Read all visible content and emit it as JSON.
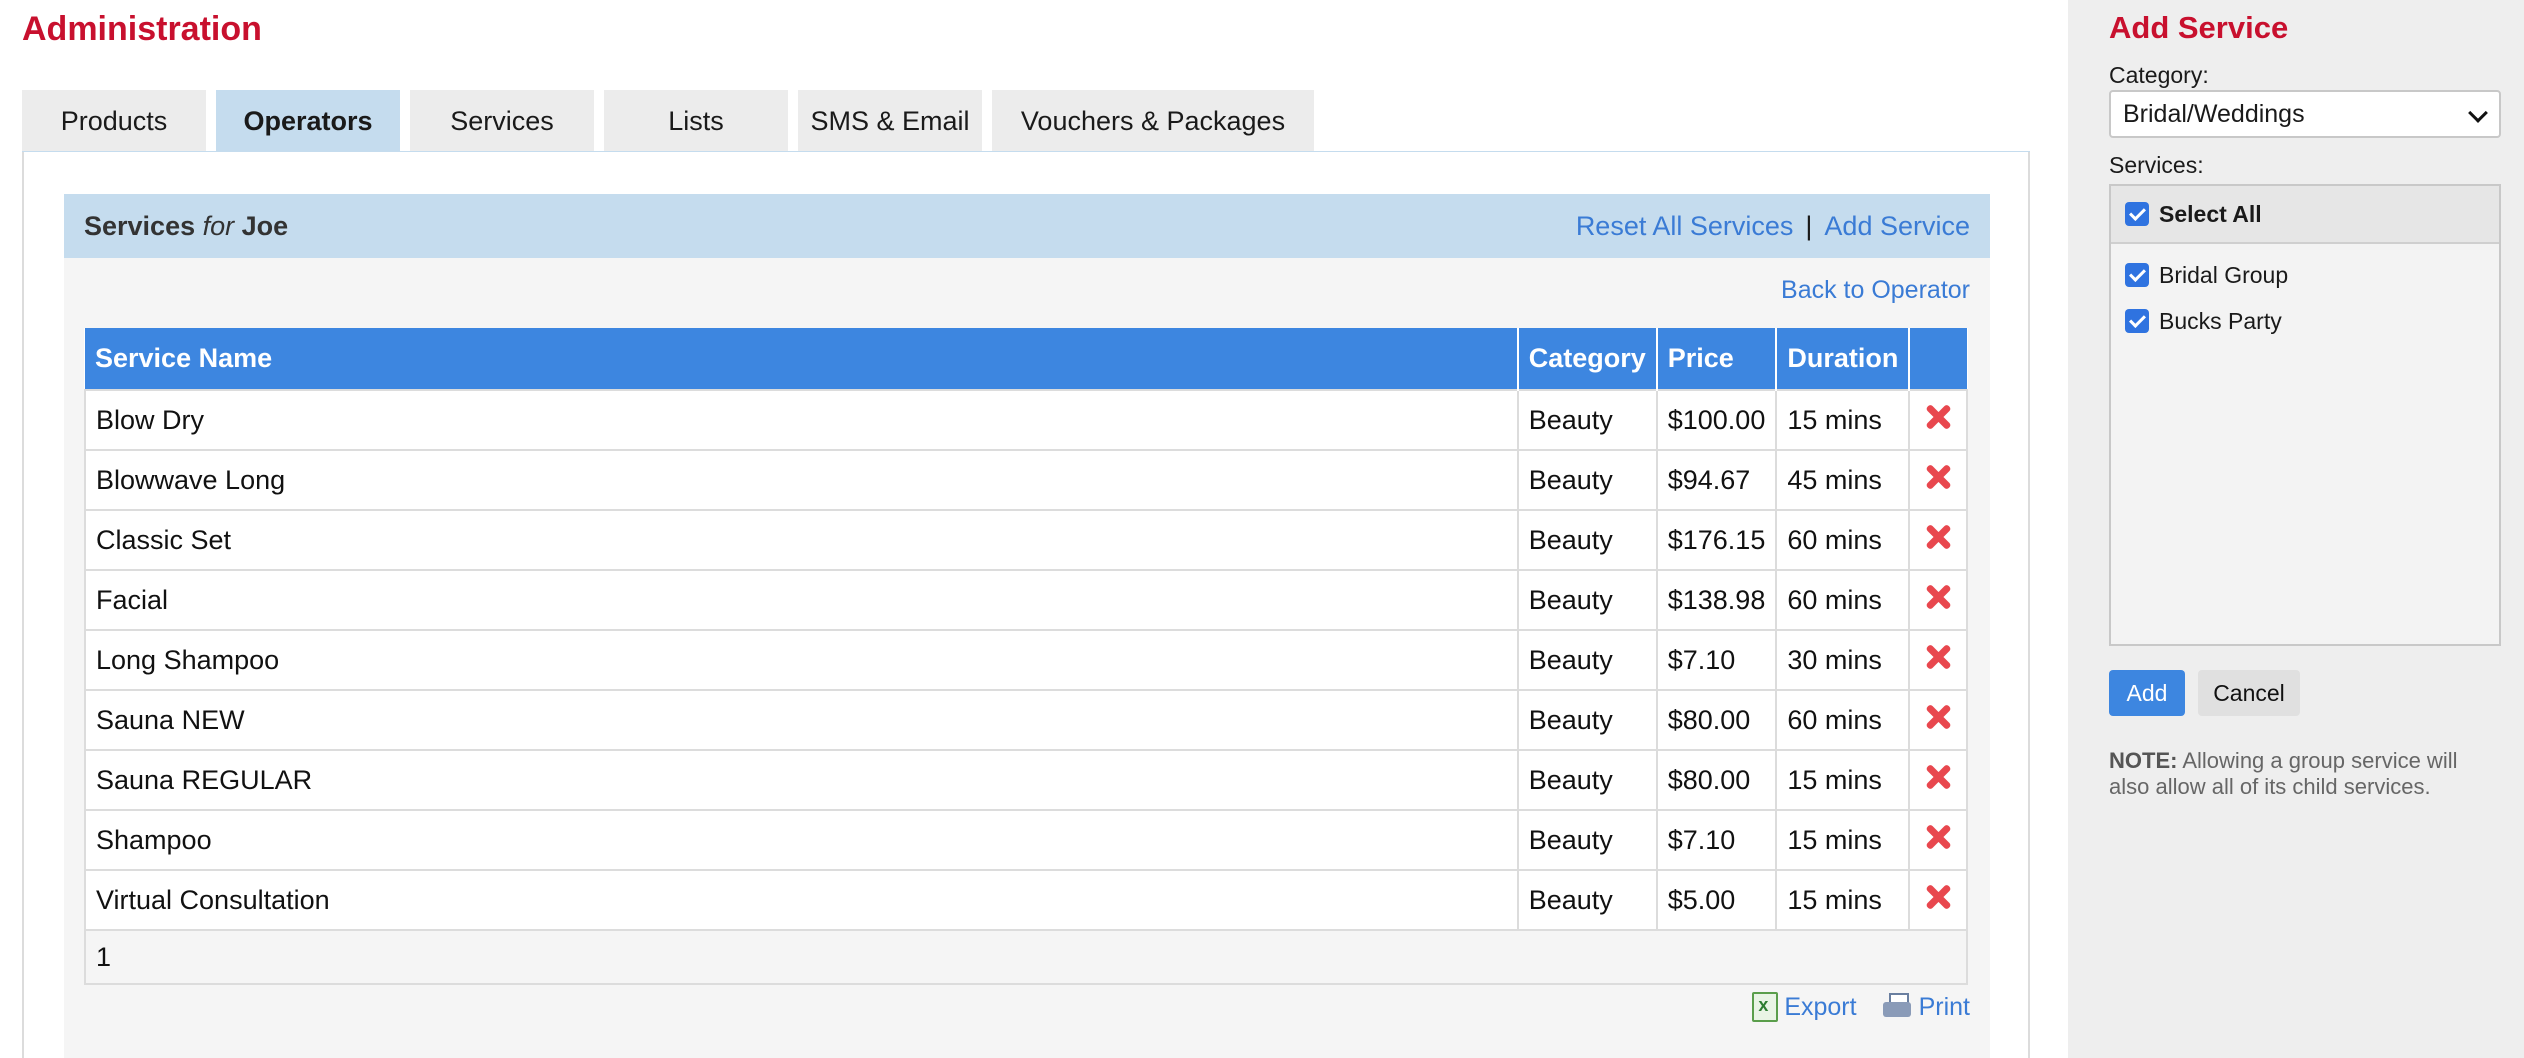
{
  "page": {
    "title": "Administration"
  },
  "tabs": [
    {
      "label": "Products",
      "active": false
    },
    {
      "label": "Operators",
      "active": true
    },
    {
      "label": "Services",
      "active": false
    },
    {
      "label": "Lists",
      "active": false
    },
    {
      "label": "SMS & Email",
      "active": false
    },
    {
      "label": "Vouchers & Packages",
      "active": false
    }
  ],
  "panel": {
    "title_prefix": "Services",
    "title_for": "for",
    "operator_name": "Joe",
    "reset_link": "Reset All Services",
    "separator": "|",
    "add_link": "Add Service",
    "back_link": "Back to Operator"
  },
  "table": {
    "headers": [
      "Service Name",
      "Category",
      "Price",
      "Duration",
      ""
    ],
    "rows": [
      {
        "name": "Blow Dry",
        "category": "Beauty",
        "price": "$100.00",
        "duration": "15 mins"
      },
      {
        "name": "Blowwave Long",
        "category": "Beauty",
        "price": "$94.67",
        "duration": "45 mins"
      },
      {
        "name": "Classic Set",
        "category": "Beauty",
        "price": "$176.15",
        "duration": "60 mins"
      },
      {
        "name": "Facial",
        "category": "Beauty",
        "price": "$138.98",
        "duration": "60 mins"
      },
      {
        "name": "Long Shampoo",
        "category": "Beauty",
        "price": "$7.10",
        "duration": "30 mins"
      },
      {
        "name": "Sauna NEW",
        "category": "Beauty",
        "price": "$80.00",
        "duration": "60 mins"
      },
      {
        "name": "Sauna REGULAR",
        "category": "Beauty",
        "price": "$80.00",
        "duration": "15 mins"
      },
      {
        "name": "Shampoo",
        "category": "Beauty",
        "price": "$7.10",
        "duration": "15 mins"
      },
      {
        "name": "Virtual Consultation",
        "category": "Beauty",
        "price": "$5.00",
        "duration": "15 mins"
      }
    ],
    "page_number": "1",
    "delete_icon": "red-x-icon"
  },
  "footer": {
    "export_label": "Export",
    "print_label": "Print"
  },
  "sidebar": {
    "title": "Add Service",
    "category_label": "Category:",
    "category_value": "Bridal/Weddings",
    "services_label": "Services:",
    "select_all": "Select All",
    "services": [
      {
        "label": "Bridal Group",
        "checked": true
      },
      {
        "label": "Bucks Party",
        "checked": true
      }
    ],
    "add_button": "Add",
    "cancel_button": "Cancel",
    "note_label": "NOTE:",
    "note_text": "Allowing a group service will also allow all of its child services."
  },
  "colors": {
    "title_red": "#c8102e",
    "tab_active": "#c5dcee",
    "header_blue": "#3d86e0",
    "link_blue": "#3a7bd5",
    "delete_red": "#e8474e"
  }
}
